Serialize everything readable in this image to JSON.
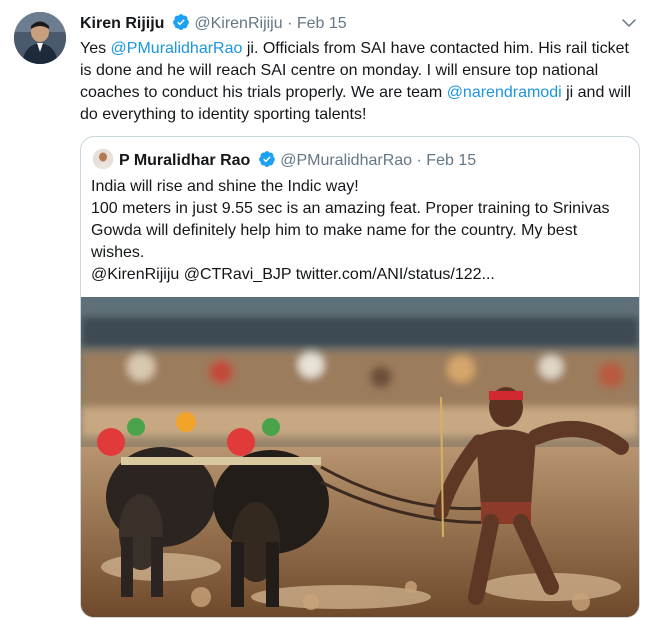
{
  "tweet": {
    "author_name": "Kiren Rijiju",
    "author_handle": "@KirenRijiju",
    "separator": "·",
    "date": "Feb 15",
    "body": {
      "t1": "Yes ",
      "m1": "@PMuralidharRao",
      "t2": " ji. Officials from SAI have contacted him. His rail ticket is done and he will reach SAI centre on monday. I will ensure top national coaches to conduct his trials properly. We are team ",
      "m2": "@narendramodi",
      "t3": " ji and will do everything to identity sporting talents!"
    }
  },
  "quoted": {
    "author_name": "P Muralidhar Rao",
    "author_handle": "@PMuralidharRao",
    "separator": "·",
    "date": "Feb 15",
    "line1": "India will rise and shine the Indic way!",
    "line2": "100 meters in just 9.55 sec is an amazing feat. Proper training to Srinivas Gowda will definitely help him to make name for the country. My best wishes.",
    "line3": "@KirenRijiju @CTRavi_BJP twitter.com/ANI/status/122..."
  },
  "colors": {
    "link": "#1b95e0",
    "verified": "#1da1f2",
    "muted": "#657786",
    "border": "#ccd6dd"
  },
  "icons": {
    "verified": "verified-badge-icon",
    "menu": "chevron-down-icon"
  }
}
